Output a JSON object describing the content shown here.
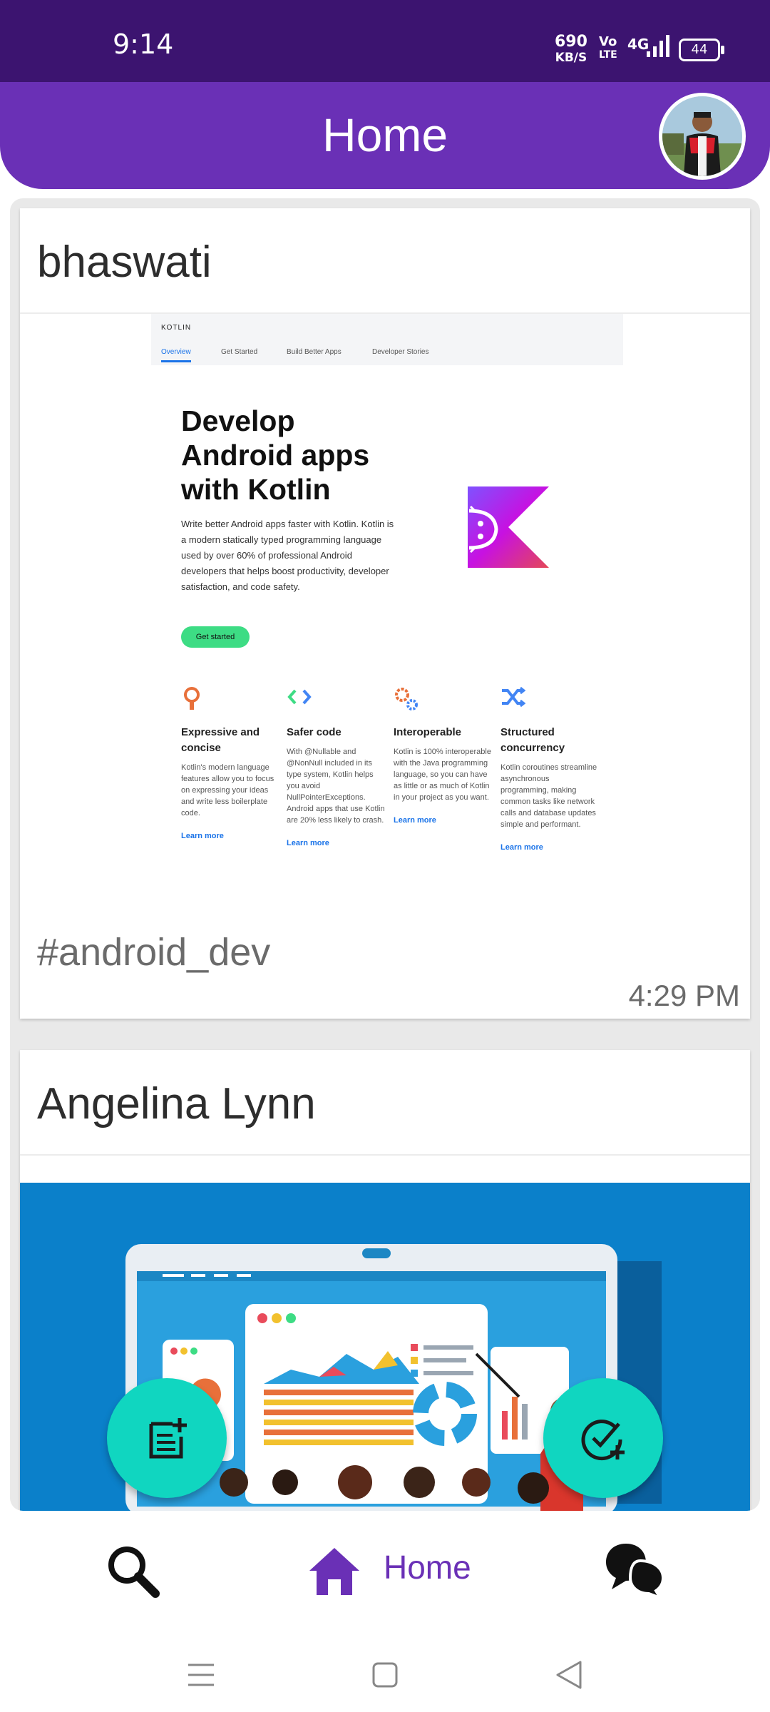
{
  "status_bar": {
    "time": "9:14",
    "speed_value": "690",
    "speed_unit": "KB/S",
    "volte_top": "Vo",
    "volte_bottom": "LTE",
    "network": "4G",
    "battery": "44"
  },
  "app_bar": {
    "title": "Home"
  },
  "posts": [
    {
      "author": "bhaswati",
      "tag": "#android_dev",
      "time": "4:29 PM",
      "image": {
        "brand": "KOTLIN",
        "tabs": [
          "Overview",
          "Get Started",
          "Build Better Apps",
          "Developer Stories"
        ],
        "headline_1": "Develop",
        "headline_2": "Android apps",
        "headline_3": "with Kotlin",
        "description": "Write better Android apps faster with Kotlin. Kotlin is a modern statically typed programming language used by over 60% of professional Android developers that helps boost productivity, developer satisfaction, and code safety.",
        "button": "Get started",
        "features": [
          {
            "title": "Expressive and concise",
            "text": "Kotlin's modern language features allow you to focus on expressing your ideas and write less boilerplate code.",
            "link": "Learn more"
          },
          {
            "title": "Safer code",
            "text": "With @Nullable and @NonNull included in its type system, Kotlin helps you avoid NullPointerExceptions. Android apps that use Kotlin are 20% less likely to crash.",
            "link": "Learn more"
          },
          {
            "title": "Interoperable",
            "text": "Kotlin is 100% interoperable with the Java programming language, so you can have as little or as much of Kotlin in your project as you want.",
            "link": "Learn more"
          },
          {
            "title": "Structured concurrency",
            "text": "Kotlin coroutines streamline asynchronous programming, making common tasks like network calls and database updates simple and performant.",
            "link": "Learn more"
          }
        ]
      }
    },
    {
      "author": "Angelina Lynn"
    }
  ],
  "bottom_nav": {
    "home_label": "Home"
  },
  "colors": {
    "status_bar": "#3c1470",
    "app_bar": "#6a30b6",
    "fab": "#10d6c0",
    "accent": "#6a30b6"
  }
}
